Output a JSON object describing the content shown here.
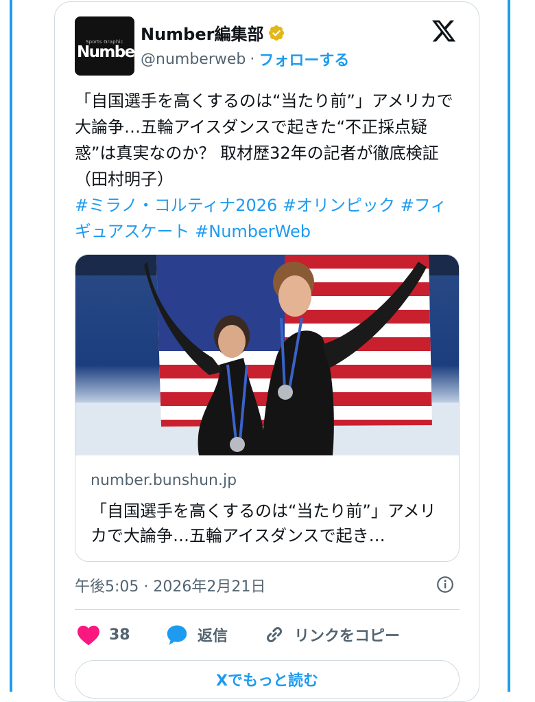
{
  "author": {
    "display_name": "Number編集部",
    "handle": "@numberweb",
    "separator": "·",
    "follow_label": "フォローする",
    "avatar_text": "Number",
    "avatar_subtext": "Sports Graphic"
  },
  "tweet": {
    "text": "「自国選手を高くするのは“当たり前”」アメリカで大論争…五輪アイスダンスで起きた“不正採点疑惑”は真実なのか？ 取材歴32年の記者が徹底検証（田村明子）",
    "hashtags": "#ミラノ・コルティナ2026 #オリンピック #フィギュアスケート #NumberWeb"
  },
  "link_card": {
    "domain": "number.bunshun.jp",
    "title": "「自国選手を高くするのは“当たり前”」アメリカで大論争…五輪アイスダンスで起き…"
  },
  "meta": {
    "timestamp": "午後5:05 · 2026年2月21日"
  },
  "actions": {
    "like_count": "38",
    "reply_label": "返信",
    "copy_link_label": "リンクをコピー"
  },
  "read_more_label": "Xでもっと読む",
  "icons": {
    "verified": "verified-badge-icon",
    "x_logo": "x-logo-icon",
    "info": "info-icon",
    "like": "heart-icon",
    "reply": "reply-bubble-icon",
    "link": "link-icon"
  },
  "colors": {
    "accent": "#1d9bf0",
    "like": "#f91880",
    "verified_gold": "#e2b719",
    "secondary_text": "#536471",
    "border": "#cfd9de"
  }
}
